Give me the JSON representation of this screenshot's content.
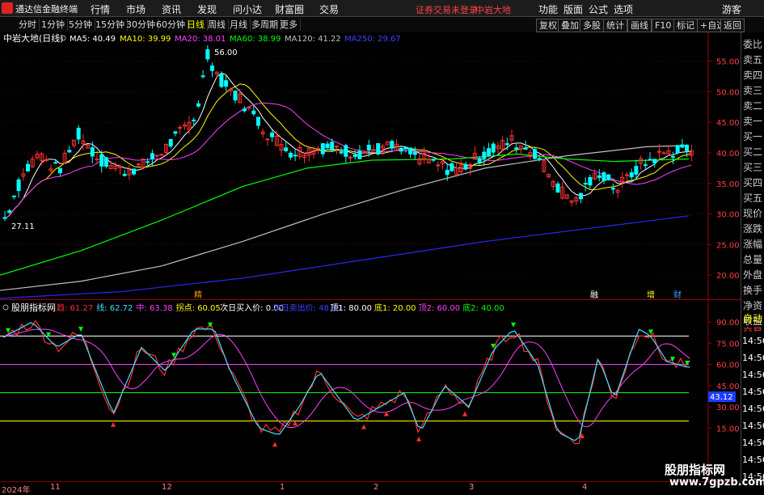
{
  "menubar": {
    "app_name": "通达信金融终端",
    "menus": [
      "行情",
      "市场",
      "资讯",
      "发现",
      "问小达",
      "财富圈",
      "交易"
    ],
    "notice": "证券交易未登录",
    "stock_name": "中岩大地",
    "right_menus": [
      "功能",
      "版面",
      "公式",
      "选项"
    ],
    "guest": "游客"
  },
  "toolbar": {
    "periods": [
      "分时",
      "1分钟",
      "5分钟",
      "15分钟",
      "30分钟",
      "60分钟",
      "日线",
      "周线",
      "月线",
      "多周期",
      "更多"
    ],
    "selected": "日线",
    "right_buttons": [
      "复权",
      "叠加",
      "多股",
      "统计",
      "画线",
      "F10",
      "标记",
      "+自选",
      "返回"
    ]
  },
  "main_chart": {
    "title": "中岩大地(日线)",
    "ma_labels": [
      {
        "text": "MA5: 40.49",
        "color": "#ffffff"
      },
      {
        "text": "MA10: 39.99",
        "color": "#ffff00"
      },
      {
        "text": "MA20: 38.01",
        "color": "#ff40ff"
      },
      {
        "text": "MA60: 38.99",
        "color": "#00ff00"
      },
      {
        "text": "MA120: 41.22",
        "color": "#c0c0c0"
      },
      {
        "text": "MA250: 29.67",
        "color": "#4040ff"
      }
    ],
    "y_ticks": [
      "55.00",
      "50.00",
      "45.00",
      "40.00",
      "35.00",
      "30.00",
      "25.00",
      "20.00"
    ],
    "high_label": "56.00",
    "low_label": "27.11",
    "events": [
      "精",
      "融",
      "增",
      "财"
    ]
  },
  "indicator": {
    "title": "股朋指标网",
    "labels": [
      {
        "text": "趋: 61.27",
        "color": "#ff3030"
      },
      {
        "text": "线: 62.72",
        "color": "#40e0ff"
      },
      {
        "text": "中: 63.38",
        "color": "#ff40ff"
      },
      {
        "text": "拐点: 60.05",
        "color": "#ffff00"
      },
      {
        "text": "次日买入价: 0.00",
        "color": "#ffffff"
      },
      {
        "text": "次日卖出价: 48.89",
        "color": "#4040ff"
      },
      {
        "text": "顶1: 80.00",
        "color": "#ffffff"
      },
      {
        "text": "底1: 20.00",
        "color": "#ffff00"
      },
      {
        "text": "顶2: 60.00",
        "color": "#ff40ff"
      },
      {
        "text": "底2: 40.00",
        "color": "#00ff00"
      }
    ],
    "y_ticks": [
      "90.00",
      "75.00",
      "60.00",
      "45.00",
      "30.00",
      "15.00"
    ],
    "current_value": "43.12"
  },
  "sidebar": {
    "items": [
      "委比",
      "卖五",
      "卖四",
      "卖三",
      "卖二",
      "卖一",
      "买一",
      "买二",
      "买三",
      "买四",
      "买五",
      "现价",
      "涨跌",
      "涨幅",
      "总量",
      "外盘",
      "换手",
      "净资",
      "收益"
    ],
    "bottom_items": [
      "自动",
      "交易"
    ],
    "times": [
      "14:56",
      "14:56",
      "14:56",
      "14:56",
      "14:56",
      "14:56",
      "14:56",
      "14:56",
      "14:56"
    ]
  },
  "timebar": {
    "labels": [
      "2024年",
      "11",
      "12",
      "1",
      "2",
      "3",
      "4"
    ]
  },
  "watermark": {
    "line1": "股朋指标网",
    "line2": "www.7gpzb.com"
  },
  "colors": {
    "up": "#ff3030",
    "down": "#00ffff",
    "grid": "#800000",
    "accent": "#ffff00"
  }
}
